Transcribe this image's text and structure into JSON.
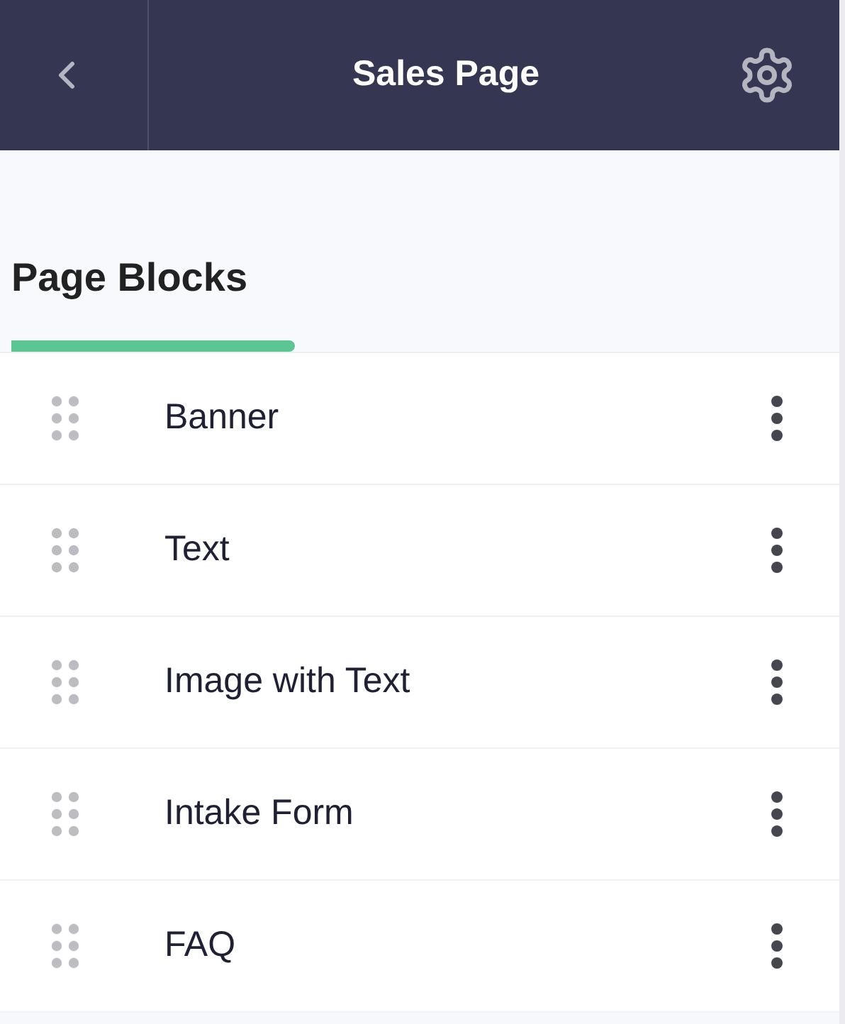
{
  "header": {
    "title": "Sales Page"
  },
  "tabs": [
    {
      "label": "Page Blocks",
      "selected": true
    }
  ],
  "blocks": [
    {
      "label": "Banner"
    },
    {
      "label": "Text"
    },
    {
      "label": "Image with Text"
    },
    {
      "label": "Intake Form"
    },
    {
      "label": "FAQ"
    }
  ]
}
